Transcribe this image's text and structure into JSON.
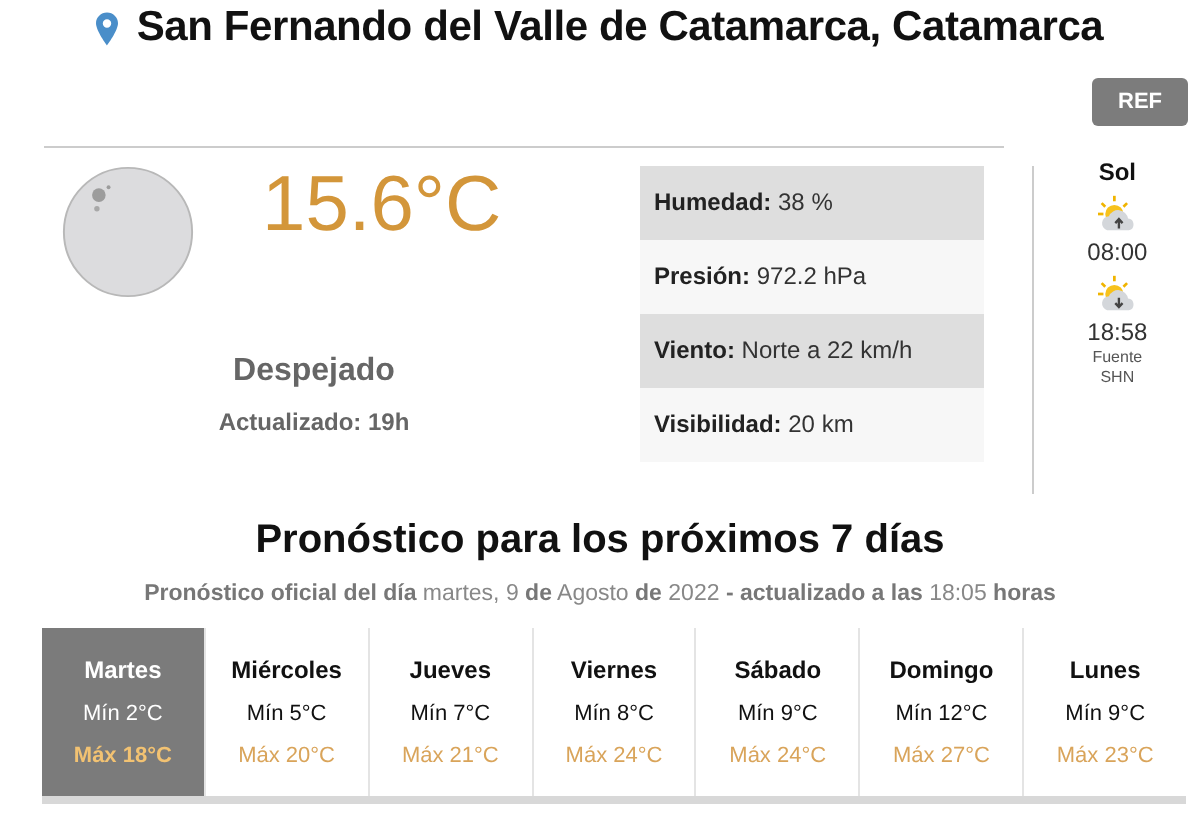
{
  "location": {
    "title": "San Fernando del Valle de Catamarca, Catamarca"
  },
  "ref_button": "REF",
  "current": {
    "temperature": "15.6°C",
    "condition": "Despejado",
    "updated": "Actualizado: 19h"
  },
  "details": [
    {
      "label": "Humedad:",
      "value": "38 %"
    },
    {
      "label": "Presión:",
      "value": "972.2 hPa"
    },
    {
      "label": "Viento:",
      "value": "Norte a 22 km/h"
    },
    {
      "label": "Visibilidad:",
      "value": "20 km"
    }
  ],
  "sun": {
    "title": "Sol",
    "events": [
      {
        "kind": "sunrise",
        "time": "08:00"
      },
      {
        "kind": "sunset",
        "time": "18:58"
      }
    ],
    "source": "Fuente",
    "source_name": "SHN"
  },
  "forecast": {
    "title": "Pronóstico para los próximos 7 días",
    "subtitle": "**Pronóstico oficial del día** martes, 9 **de** Agosto **de** 2022 **- actualizado a las** 18:05 **horas**",
    "days": [
      {
        "day": "Martes",
        "min": "Mín 2°C",
        "max": "Máx 18°C",
        "selected": true
      },
      {
        "day": "Miércoles",
        "min": "Mín 5°C",
        "max": "Máx 20°C",
        "selected": false
      },
      {
        "day": "Jueves",
        "min": "Mín 7°C",
        "max": "Máx 21°C",
        "selected": false
      },
      {
        "day": "Viernes",
        "min": "Mín 8°C",
        "max": "Máx 24°C",
        "selected": false
      },
      {
        "day": "Sábado",
        "min": "Mín 9°C",
        "max": "Máx 24°C",
        "selected": false
      },
      {
        "day": "Domingo",
        "min": "Mín 12°C",
        "max": "Máx 27°C",
        "selected": false
      },
      {
        "day": "Lunes",
        "min": "Mín 9°C",
        "max": "Máx 23°C",
        "selected": false
      }
    ]
  }
}
